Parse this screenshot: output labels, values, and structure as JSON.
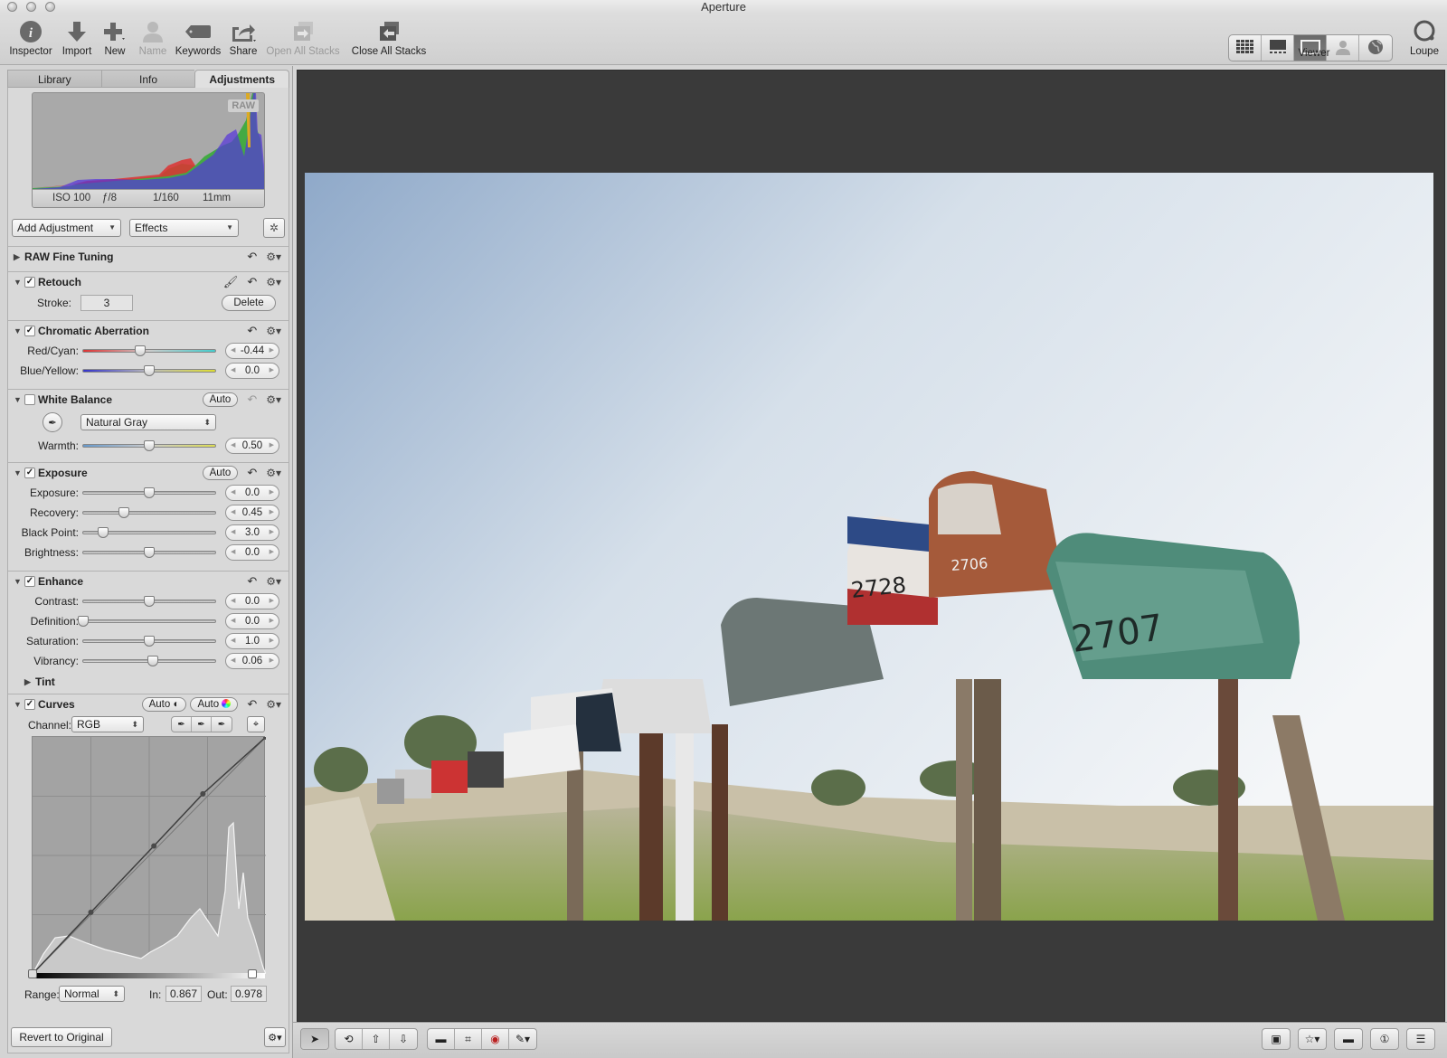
{
  "window": {
    "title": "Aperture"
  },
  "toolbar": {
    "items": [
      {
        "label": "Inspector",
        "icon": "info-icon",
        "enabled": true
      },
      {
        "label": "Import",
        "icon": "import-arrow-icon",
        "enabled": true
      },
      {
        "label": "New",
        "icon": "plus-icon",
        "enabled": true
      },
      {
        "label": "Name",
        "icon": "person-icon",
        "enabled": false
      },
      {
        "label": "Keywords",
        "icon": "tag-icon",
        "enabled": true
      },
      {
        "label": "Share",
        "icon": "share-icon",
        "enabled": true
      },
      {
        "label": "Open All Stacks",
        "icon": "open-stacks-icon",
        "enabled": false
      },
      {
        "label": "Close All Stacks",
        "icon": "close-stacks-icon",
        "enabled": true
      }
    ],
    "viewer_label": "Viewer",
    "viewer_modes": [
      "grid-view-icon",
      "filmstrip-view-icon",
      "viewer-only-icon",
      "faces-icon",
      "places-globe-icon"
    ],
    "viewer_active": "viewer-only-icon",
    "loupe_label": "Loupe"
  },
  "inspector": {
    "tabs": [
      {
        "label": "Library",
        "active": false
      },
      {
        "label": "Info",
        "active": false
      },
      {
        "label": "Adjustments",
        "active": true
      }
    ],
    "histogram": {
      "badge": "RAW",
      "iso": "ISO 100",
      "aperture": "ƒ/8",
      "shutter": "1/160",
      "focal_length": "11mm"
    },
    "add_adjustment": "Add Adjustment",
    "effects": "Effects",
    "raw_fine_tuning": {
      "title": "RAW Fine Tuning"
    },
    "retouch": {
      "title": "Retouch",
      "checked": true,
      "stroke_label": "Stroke:",
      "stroke_value": "3",
      "delete_label": "Delete"
    },
    "chromatic_aberration": {
      "title": "Chromatic Aberration",
      "checked": true,
      "sliders": [
        {
          "label": "Red/Cyan:",
          "value": "-0.44",
          "position": 0.43
        },
        {
          "label": "Blue/Yellow:",
          "value": "0.0",
          "position": 0.5
        }
      ]
    },
    "white_balance": {
      "title": "White Balance",
      "checked": false,
      "auto_label": "Auto",
      "mode": "Natural Gray",
      "sliders": [
        {
          "label": "Warmth:",
          "value": "0.50",
          "position": 0.5
        }
      ]
    },
    "exposure": {
      "title": "Exposure",
      "checked": true,
      "auto_label": "Auto",
      "sliders": [
        {
          "label": "Exposure:",
          "value": "0.0",
          "position": 0.5
        },
        {
          "label": "Recovery:",
          "value": "0.45",
          "position": 0.31
        },
        {
          "label": "Black Point:",
          "value": "3.0",
          "position": 0.15
        },
        {
          "label": "Brightness:",
          "value": "0.0",
          "position": 0.5
        }
      ]
    },
    "enhance": {
      "title": "Enhance",
      "checked": true,
      "sliders": [
        {
          "label": "Contrast:",
          "value": "0.0",
          "position": 0.5
        },
        {
          "label": "Definition:",
          "value": "0.0",
          "position": 0.0
        },
        {
          "label": "Saturation:",
          "value": "1.0",
          "position": 0.5
        },
        {
          "label": "Vibrancy:",
          "value": "0.06",
          "position": 0.53
        }
      ],
      "tint_label": "Tint"
    },
    "curves": {
      "title": "Curves",
      "checked": true,
      "auto_luma_label": "Auto",
      "auto_color_label": "Auto",
      "channel_label": "Channel:",
      "channel_value": "RGB",
      "range_label": "Range:",
      "range_value": "Normal",
      "in_label": "In:",
      "in_value": "0.867",
      "out_label": "Out:",
      "out_value": "0.978",
      "points": [
        [
          0,
          0
        ],
        [
          0.25,
          0.26
        ],
        [
          0.52,
          0.54
        ],
        [
          0.73,
          0.76
        ],
        [
          1,
          1
        ]
      ]
    },
    "revert_label": "Revert to Original"
  },
  "bottom_bar": {
    "tools": [
      "select-arrow-icon",
      "rotate-icon",
      "lift-icon",
      "stamp-icon",
      "straighten-icon",
      "crop-icon",
      "red-eye-icon",
      "brush-icon"
    ],
    "right_buttons": [
      "fullscreen-icon",
      "metadata-overlay-icon",
      "filmstrip-icon",
      "primary-only-icon",
      "browser-toggle-icon"
    ]
  }
}
